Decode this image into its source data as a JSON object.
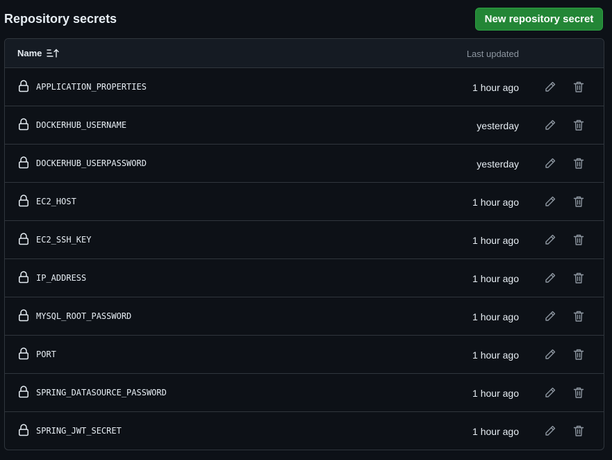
{
  "header": {
    "title": "Repository secrets",
    "new_button_label": "New repository secret"
  },
  "table": {
    "col_name": "Name",
    "col_updated": "Last updated",
    "rows": [
      {
        "name": "APPLICATION_PROPERTIES",
        "updated": "1 hour ago"
      },
      {
        "name": "DOCKERHUB_USERNAME",
        "updated": "yesterday"
      },
      {
        "name": "DOCKERHUB_USERPASSWORD",
        "updated": "yesterday"
      },
      {
        "name": "EC2_HOST",
        "updated": "1 hour ago"
      },
      {
        "name": "EC2_SSH_KEY",
        "updated": "1 hour ago"
      },
      {
        "name": "IP_ADDRESS",
        "updated": "1 hour ago"
      },
      {
        "name": "MYSQL_ROOT_PASSWORD",
        "updated": "1 hour ago"
      },
      {
        "name": "PORT",
        "updated": "1 hour ago"
      },
      {
        "name": "SPRING_DATASOURCE_PASSWORD",
        "updated": "1 hour ago"
      },
      {
        "name": "SPRING_JWT_SECRET",
        "updated": "1 hour ago"
      }
    ]
  },
  "icons": {
    "lock": "lock-icon",
    "edit": "pencil-icon",
    "delete": "trash-icon",
    "sort": "sort-ascending-icon"
  },
  "colors": {
    "background": "#0d1117",
    "header_bg": "#151b23",
    "border": "#30363d",
    "primary_button": "#238636",
    "muted_text": "#8d96a0",
    "text": "#e6edf3"
  }
}
